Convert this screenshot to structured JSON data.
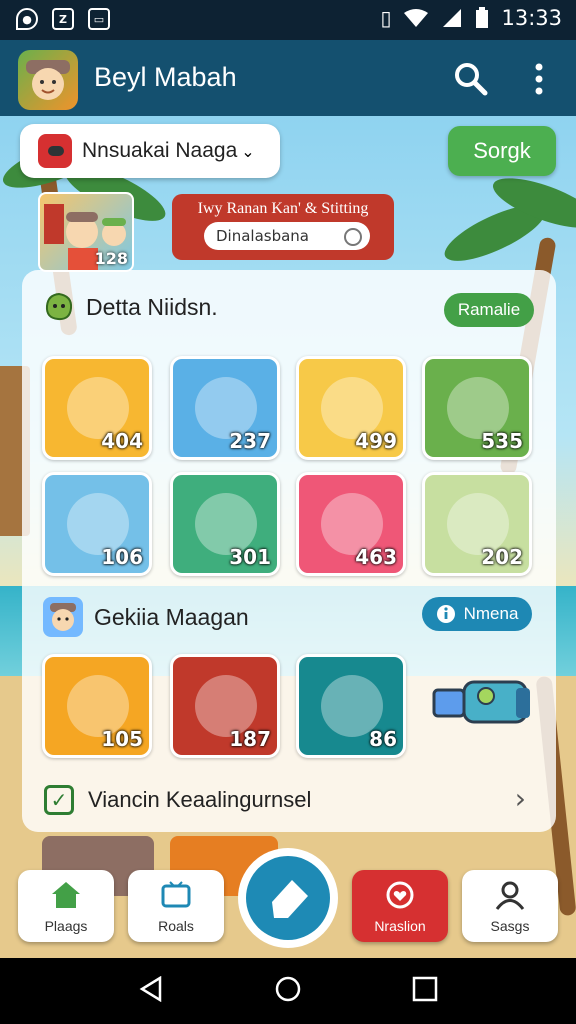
{
  "status": {
    "time": "13:33"
  },
  "appbar": {
    "title": "Beyl Mabah"
  },
  "toolbar": {
    "selector_label": "Nnsuakai Naaga",
    "sort_label": "Sorgk"
  },
  "hero": {
    "count": "128"
  },
  "banner": {
    "title": "Iwy Ranan Kan' & Stitting",
    "input_value": "Dinalasbana"
  },
  "section1": {
    "title": "Detta Niidsn.",
    "action": "Ramalie",
    "tiles": [
      {
        "value": "404",
        "color": "#f7b731"
      },
      {
        "value": "237",
        "color": "#5ab0e6"
      },
      {
        "value": "499",
        "color": "#f7c948"
      },
      {
        "value": "535",
        "color": "#6ab04c"
      },
      {
        "value": "106",
        "color": "#74c0e8"
      },
      {
        "value": "301",
        "color": "#3fae7d"
      },
      {
        "value": "463",
        "color": "#ef5777"
      },
      {
        "value": "202",
        "color": "#c7dfa0"
      }
    ]
  },
  "section2": {
    "title": "Gekiia Maagan",
    "action": "Nmena",
    "tiles": [
      {
        "value": "105",
        "color": "#f5a623"
      },
      {
        "value": "187",
        "color": "#c0392b"
      },
      {
        "value": "86",
        "color": "#17898f"
      }
    ]
  },
  "row_link": {
    "label": "Viancin Keaalingurnsel"
  },
  "bottom_nav": {
    "items": [
      {
        "label": "Plaags"
      },
      {
        "label": "Roals"
      },
      {
        "label": "Nraslion"
      },
      {
        "label": "Sasgs"
      }
    ]
  }
}
